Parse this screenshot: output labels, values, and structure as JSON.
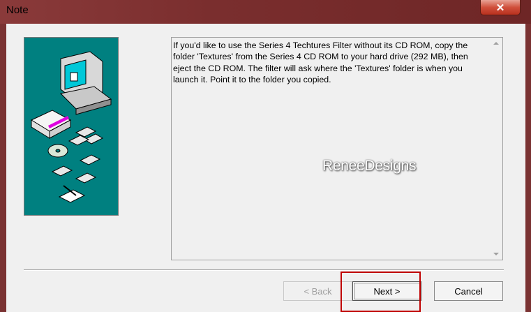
{
  "window": {
    "title": "Note",
    "close_glyph": "✕"
  },
  "sidebar": {
    "icon": "computer-install-illustration"
  },
  "message": {
    "lines": [
      "If you'd like to use the Series 4 Techtures Filter without its CD ROM, copy the",
      "folder 'Textures'  from the Series 4 CD ROM to your hard drive (292 MB), then",
      "eject the CD ROM. The filter will ask where the 'Textures' folder is when you",
      "launch it. Point it to the folder you copied."
    ]
  },
  "watermark": "ReneeDesigns",
  "buttons": {
    "back": "< Back",
    "next": "Next >",
    "cancel": "Cancel"
  },
  "colors": {
    "titlebar": "#7a2e2e",
    "art_background": "#008080",
    "highlight": "#c00000"
  }
}
